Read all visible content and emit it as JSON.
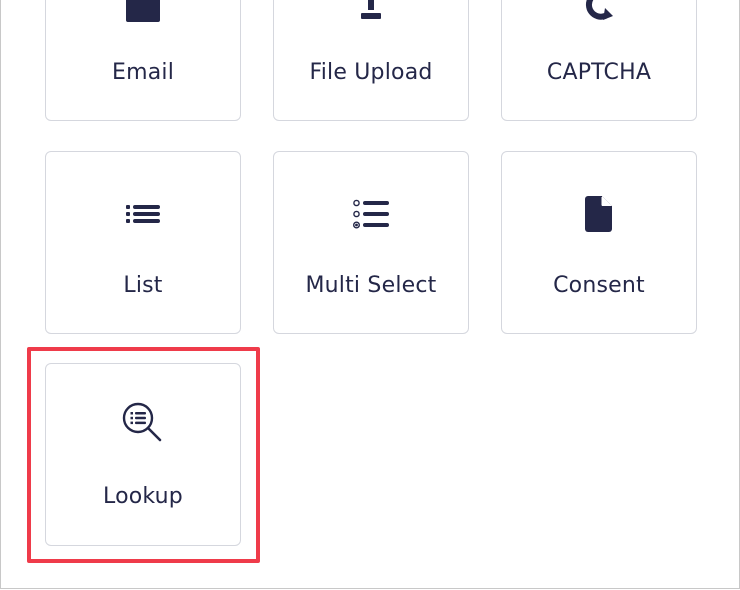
{
  "fields": {
    "email": {
      "label": "Email",
      "icon": "envelope-icon"
    },
    "file_upload": {
      "label": "File Upload",
      "icon": "upload-icon"
    },
    "captcha": {
      "label": "CAPTCHA",
      "icon": "refresh-icon"
    },
    "list": {
      "label": "List",
      "icon": "list-icon"
    },
    "multi_select": {
      "label": "Multi Select",
      "icon": "multi-select-list-icon"
    },
    "consent": {
      "label": "Consent",
      "icon": "document-icon"
    },
    "lookup": {
      "label": "Lookup",
      "icon": "search-list-icon"
    }
  },
  "colors": {
    "text": "#242748",
    "icon": "#242748",
    "tile_border": "#d5d7de",
    "highlight": "#ef3b4a"
  }
}
